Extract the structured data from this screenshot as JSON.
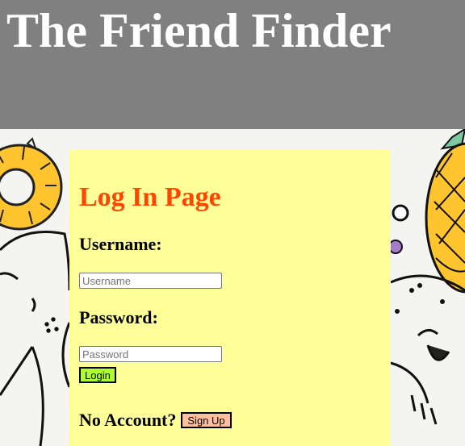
{
  "header": {
    "title": "The Friend Finder",
    "background": "#808080",
    "text_color": "#ffffff"
  },
  "backdrop": {
    "description_icons": [
      "pineapple-ring-icon",
      "cartoon-animal-icon",
      "pineapple-icon",
      "cartoon-bunny-icon"
    ]
  },
  "login": {
    "title": "Log In Page",
    "title_color": "#ff4500",
    "panel_color": "#ffff99",
    "username_label": "Username:",
    "username_placeholder": "Username",
    "username_value": "",
    "password_label": "Password:",
    "password_placeholder": "Password",
    "password_value": "",
    "login_button": "Login",
    "login_button_color": "#adff2f",
    "no_account_label": "No Account?",
    "signup_button": "Sign Up",
    "signup_button_color": "#ffc0a0"
  }
}
